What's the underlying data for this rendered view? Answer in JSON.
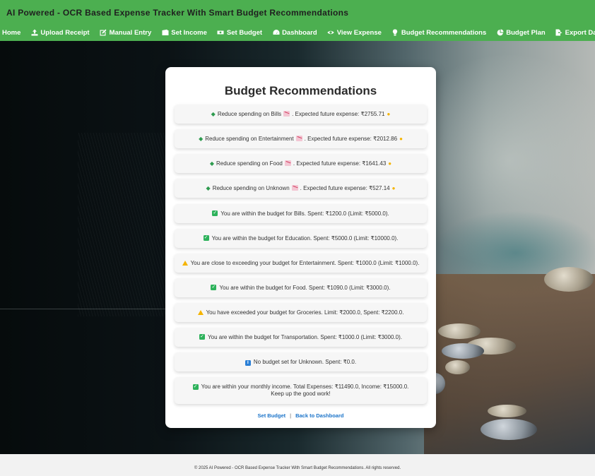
{
  "app": {
    "title": "AI Powered - OCR Based Expense Tracker With Smart Budget Recommendations"
  },
  "nav": [
    {
      "label": "Home",
      "icon": "home-icon"
    },
    {
      "label": "Upload Receipt",
      "icon": "upload-icon"
    },
    {
      "label": "Manual Entry",
      "icon": "edit-icon"
    },
    {
      "label": "Set Income",
      "icon": "wallet-icon"
    },
    {
      "label": "Set Budget",
      "icon": "money-bill-icon"
    },
    {
      "label": "Dashboard",
      "icon": "gauge-icon"
    },
    {
      "label": "View Expense",
      "icon": "eye-icon"
    },
    {
      "label": "Budget Recommendations",
      "icon": "lightbulb-icon"
    },
    {
      "label": "Budget Plan",
      "icon": "pie-chart-icon"
    },
    {
      "label": "Export Data",
      "icon": "file-export-icon"
    }
  ],
  "card": {
    "title": "Budget Recommendations",
    "recommendations": [
      {
        "kind": "reduce",
        "text": "Reduce spending on Bills",
        "suffix": ". Expected future expense: ₹2755.71"
      },
      {
        "kind": "reduce",
        "text": "Reduce spending on Entertainment",
        "suffix": ". Expected future expense: ₹2012.86"
      },
      {
        "kind": "reduce",
        "text": "Reduce spending on Food",
        "suffix": ". Expected future expense: ₹1641.43"
      },
      {
        "kind": "reduce",
        "text": "Reduce spending on Unknown",
        "suffix": ". Expected future expense: ₹527.14"
      },
      {
        "kind": "ok",
        "text": "You are within the budget for Bills. Spent: ₹1200.0 (Limit: ₹5000.0)."
      },
      {
        "kind": "ok",
        "text": "You are within the budget for Education. Spent: ₹5000.0 (Limit: ₹10000.0)."
      },
      {
        "kind": "warn",
        "text": "You are close to exceeding your budget for Entertainment. Spent: ₹1000.0 (Limit: ₹1000.0)."
      },
      {
        "kind": "ok",
        "text": "You are within the budget for Food. Spent: ₹1090.0 (Limit: ₹3000.0)."
      },
      {
        "kind": "warn",
        "text": "You have exceeded your budget for Groceries. Limit: ₹2000.0, Spent: ₹2200.0."
      },
      {
        "kind": "ok",
        "text": "You are within the budget for Transportation. Spent: ₹1000.0 (Limit: ₹3000.0)."
      },
      {
        "kind": "info",
        "text": "No budget set for Unknown. Spent: ₹0.0."
      },
      {
        "kind": "ok",
        "text": "You are within your monthly income. Total Expenses: ₹11490.0, Income: ₹15000.0. Keep up the good work!"
      }
    ],
    "links": {
      "set_budget": "Set Budget",
      "separator": "|",
      "back": "Back to Dashboard"
    }
  },
  "footer": {
    "text": "© 2025 AI Powered - OCR Based Expense Tracker With Smart Budget Recommendations. All rights reserved."
  },
  "colors": {
    "header": "#4caf50",
    "link": "#1a73c9",
    "ok": "#2db25b",
    "warn": "#f5b400",
    "info": "#2a7fd6"
  }
}
